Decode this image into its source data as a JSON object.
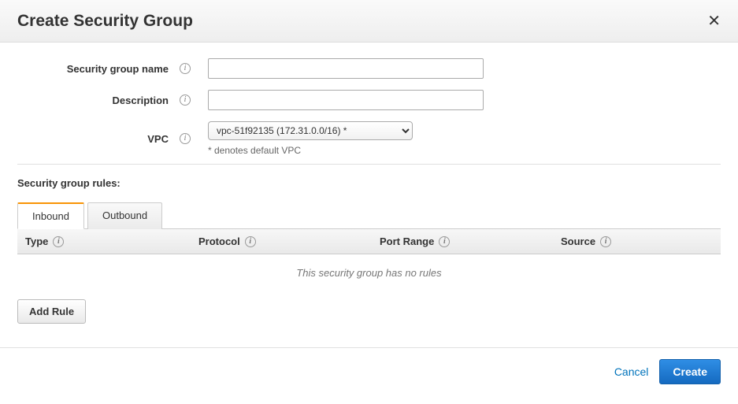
{
  "header": {
    "title": "Create Security Group"
  },
  "form": {
    "name_label": "Security group name",
    "name_value": "",
    "description_label": "Description",
    "description_value": "",
    "vpc_label": "VPC",
    "vpc_selected": "vpc-51f92135 (172.31.0.0/16) *",
    "vpc_note": "* denotes default VPC"
  },
  "rules": {
    "section_label": "Security group rules:",
    "tabs": {
      "inbound": "Inbound",
      "outbound": "Outbound"
    },
    "columns": {
      "type": "Type",
      "protocol": "Protocol",
      "port_range": "Port Range",
      "source": "Source"
    },
    "empty_message": "This security group has no rules",
    "add_rule_label": "Add Rule"
  },
  "footer": {
    "cancel": "Cancel",
    "create": "Create"
  }
}
